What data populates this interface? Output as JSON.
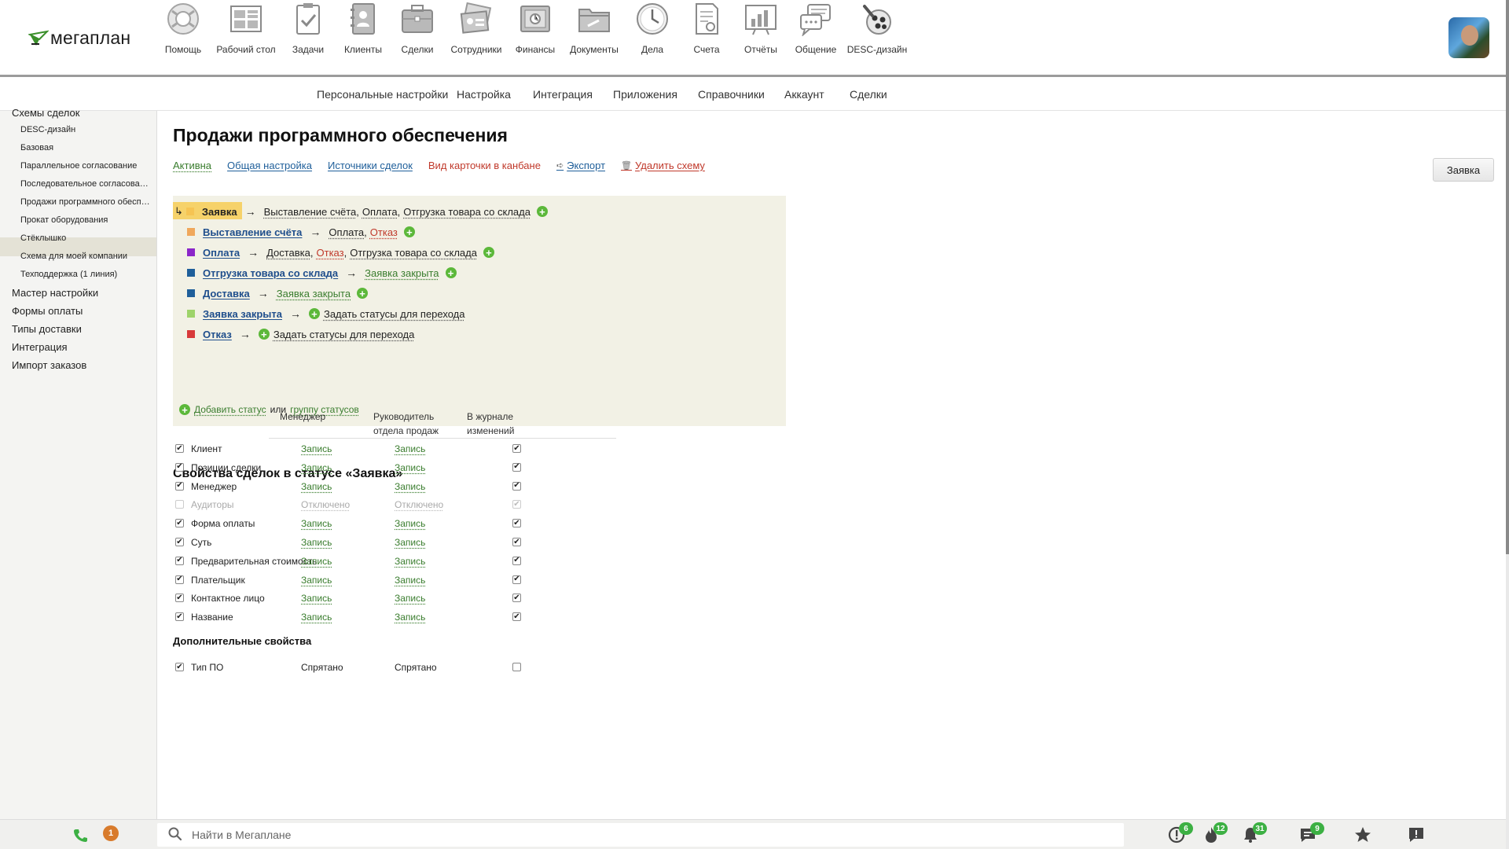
{
  "app": {
    "logo_text": "мегаплан"
  },
  "top_nav": [
    {
      "label": "Помощь",
      "icon": "lifebuoy-icon"
    },
    {
      "label": "Рабочий стол",
      "icon": "dashboard-icon"
    },
    {
      "label": "Задачи",
      "icon": "clipboard-check-icon"
    },
    {
      "label": "Клиенты",
      "icon": "contacts-book-icon"
    },
    {
      "label": "Сделки",
      "icon": "briefcase-icon"
    },
    {
      "label": "Сотрудники",
      "icon": "id-cards-icon"
    },
    {
      "label": "Финансы",
      "icon": "safe-icon"
    },
    {
      "label": "Документы",
      "icon": "folder-icon"
    },
    {
      "label": "Дела",
      "icon": "clock-icon"
    },
    {
      "label": "Счета",
      "icon": "invoice-icon"
    },
    {
      "label": "Отчёты",
      "icon": "bar-chart-icon"
    },
    {
      "label": "Общение",
      "icon": "chat-bubbles-icon"
    },
    {
      "label": "DESC-дизайн",
      "icon": "desc-design-icon"
    }
  ],
  "sub_nav": [
    "Персональные настройки",
    "Настройка",
    "Интеграция",
    "Приложения",
    "Справочники",
    "Аккаунт",
    "Сделки"
  ],
  "sidebar": {
    "items": [
      {
        "label": "Схемы сделок",
        "level": 0
      },
      {
        "label": "DESC-дизайн",
        "level": 1
      },
      {
        "label": "Базовая",
        "level": 1
      },
      {
        "label": "Параллельное согласование",
        "level": 1
      },
      {
        "label": "Последовательное согласование",
        "level": 1
      },
      {
        "label": "Продажи программного обеспечения",
        "level": 1,
        "active": true
      },
      {
        "label": "Прокат оборудования",
        "level": 1
      },
      {
        "label": "Стёклышко",
        "level": 1
      },
      {
        "label": "Схема для моей компании",
        "level": 1
      },
      {
        "label": "Техподдержка (1 линия)",
        "level": 1
      },
      {
        "label": "Мастер настройки",
        "level": 0
      },
      {
        "label": "Формы оплаты",
        "level": 0
      },
      {
        "label": "Типы доставки",
        "level": 0
      },
      {
        "label": "Интеграция",
        "level": 0
      },
      {
        "label": "Импорт заказов",
        "level": 0
      }
    ]
  },
  "main": {
    "title": "Продажи программного обеспечения",
    "actions": {
      "active": "Активна",
      "general": "Общая настройка",
      "sources": "Источники сделок",
      "kanban": "Вид карточки в канбане",
      "export": "Экспорт",
      "delete": "Удалить схему"
    },
    "right_button": "Заявка",
    "statuses": [
      {
        "name": "Заявка",
        "color": "#f6c453",
        "targets": [
          {
            "t": "Выставление счёта",
            "c": "dark"
          },
          {
            "t": "Оплата",
            "c": "dark"
          },
          {
            "t": "Отгрузка товара со склада",
            "c": "dark"
          }
        ],
        "plus_after": true
      },
      {
        "name": "Выставление счёта",
        "color": "#f0a85c",
        "targets": [
          {
            "t": "Оплата",
            "c": "dark"
          },
          {
            "t": "Отказ",
            "c": "red"
          }
        ],
        "plus_after": true
      },
      {
        "name": "Оплата",
        "color": "#8b26c9",
        "targets": [
          {
            "t": "Доставка",
            "c": "dark"
          },
          {
            "t": "Отказ",
            "c": "red"
          },
          {
            "t": "Отгрузка товара со склада",
            "c": "dark"
          }
        ],
        "plus_after": true
      },
      {
        "name": "Отгрузка товара со склада",
        "color": "#1f5f9a",
        "targets": [
          {
            "t": "Заявка закрыта",
            "c": "green"
          }
        ],
        "plus_after": true
      },
      {
        "name": "Доставка",
        "color": "#1f5f9a",
        "targets": [
          {
            "t": "Заявка закрыта",
            "c": "green"
          }
        ],
        "plus_after": true
      },
      {
        "name": "Заявка закрыта",
        "color": "#9ed36a",
        "targets": [
          {
            "t": "Задать статусы для перехода",
            "c": "dark"
          }
        ],
        "plus_before": true
      },
      {
        "name": "Отказ",
        "color": "#d83a3a",
        "targets": [
          {
            "t": "Задать статусы для перехода",
            "c": "dark"
          }
        ],
        "plus_before": true
      }
    ],
    "add_status": "Добавить статус",
    "or": "или",
    "add_group": "группу статусов",
    "props_title": "Свойства сделок в статусе «Заявка»",
    "columns": {
      "manager": "Менеджер",
      "head": "Руководитель\nотдела продаж",
      "journal": "В журнале\nизменений"
    },
    "properties": [
      {
        "name": "Клиент",
        "manager": "Запись",
        "head": "Запись",
        "checked": true,
        "journal": true
      },
      {
        "name": "Позиции сделки",
        "manager": "Запись",
        "head": "Запись",
        "checked": true,
        "journal": true
      },
      {
        "name": "Менеджер",
        "manager": "Запись",
        "head": "Запись",
        "checked": true,
        "journal": true
      },
      {
        "name": "Аудиторы",
        "manager": "Отключено",
        "head": "Отключено",
        "checked": false,
        "journal": true,
        "disabled": true
      },
      {
        "name": "Форма оплаты",
        "manager": "Запись",
        "head": "Запись",
        "checked": true,
        "journal": true
      },
      {
        "name": "Суть",
        "manager": "Запись",
        "head": "Запись",
        "checked": true,
        "journal": true
      },
      {
        "name": "Предварительная стоимость",
        "manager": "Запись",
        "head": "Запись",
        "checked": true,
        "journal": true
      },
      {
        "name": "Плательщик",
        "manager": "Запись",
        "head": "Запись",
        "checked": true,
        "journal": true
      },
      {
        "name": "Контактное лицо",
        "manager": "Запись",
        "head": "Запись",
        "checked": true,
        "journal": true
      },
      {
        "name": "Название",
        "manager": "Запись",
        "head": "Запись",
        "checked": true,
        "journal": true
      }
    ],
    "extra_title": "Дополнительные свойства",
    "extra_properties": [
      {
        "name": "Тип ПО",
        "manager": "Спрятано",
        "head": "Спрятано",
        "checked": true,
        "journal": false
      }
    ]
  },
  "bottom_bar": {
    "phone_badge": "1",
    "search_placeholder": "Найти в Мегаплане",
    "indicators": [
      {
        "icon": "alert-circle-icon",
        "badge": "6"
      },
      {
        "icon": "fire-icon",
        "badge": "12"
      },
      {
        "icon": "bell-icon",
        "badge": "31"
      },
      {
        "icon": "chat-icon",
        "badge": "9"
      },
      {
        "icon": "star-icon",
        "badge": ""
      },
      {
        "icon": "feedback-icon",
        "badge": ""
      }
    ]
  }
}
